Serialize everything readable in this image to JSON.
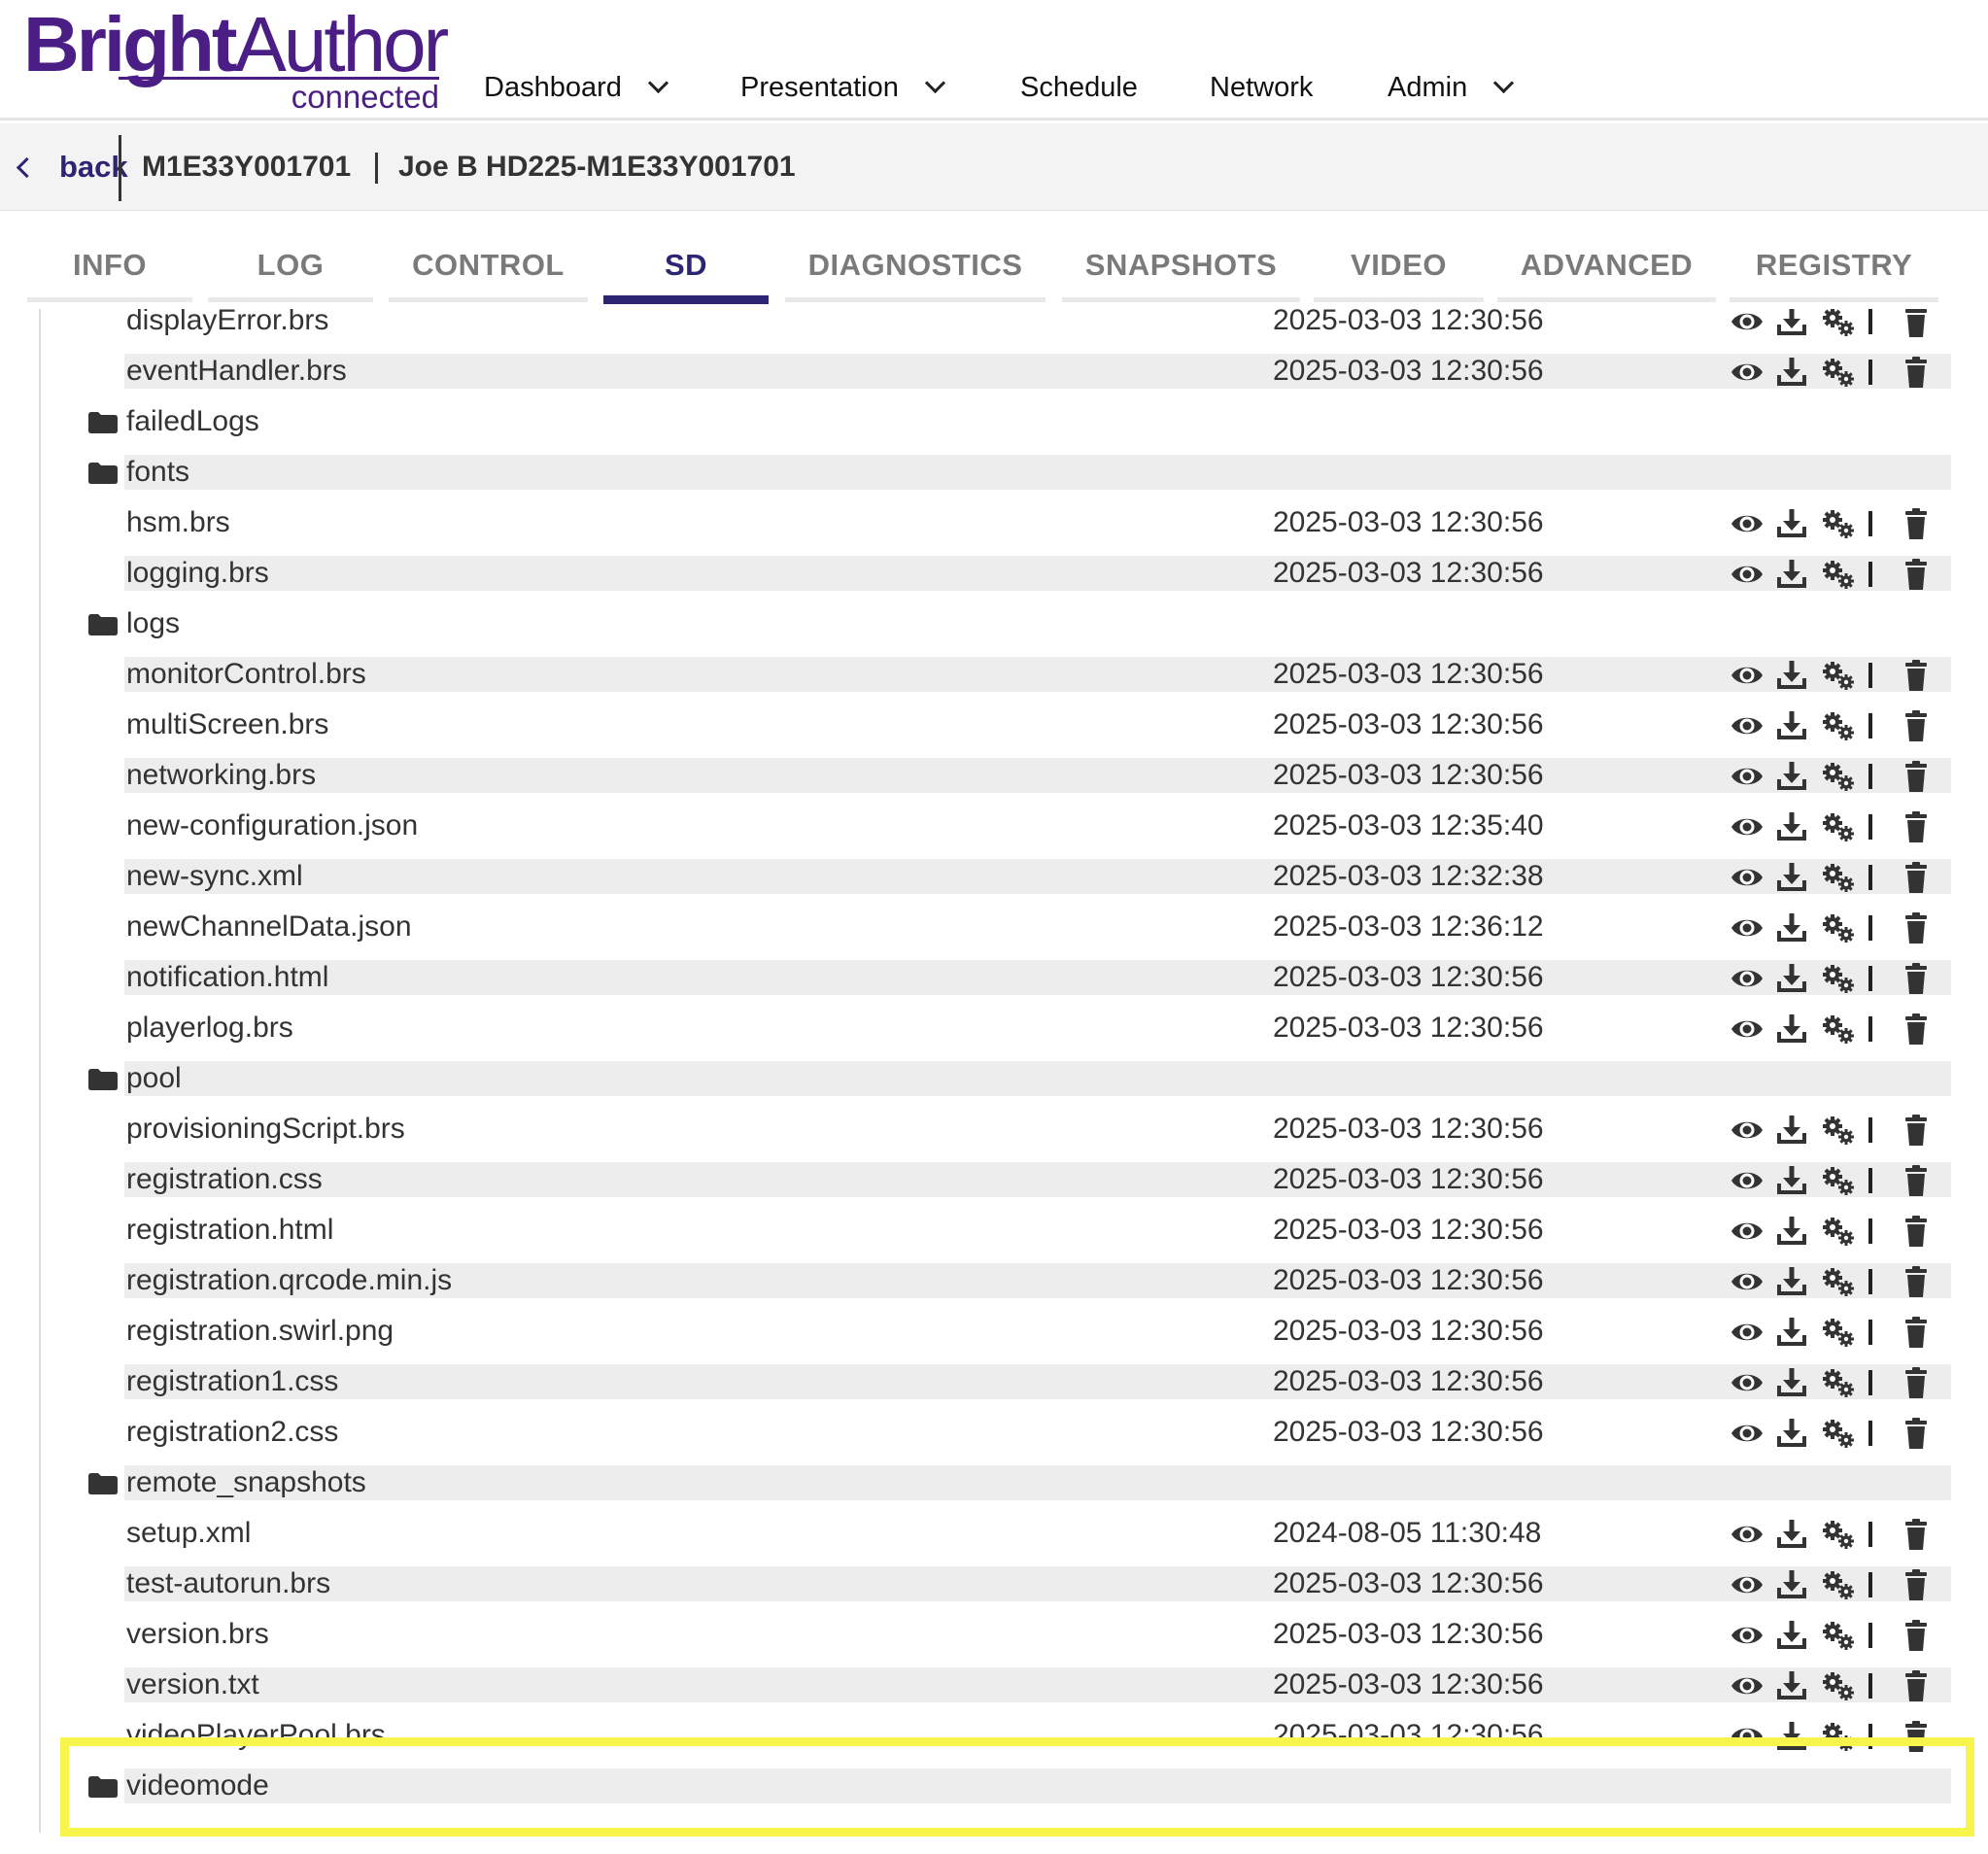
{
  "app": {
    "logo_bold": "Bright",
    "logo_light": "Author",
    "logo_sub": "connected",
    "brand_color": "#4b1e86",
    "accent_color": "#2c2573",
    "highlight_color": "#f7f44c"
  },
  "nav": {
    "items": [
      {
        "label": "Dashboard",
        "has_dropdown": true
      },
      {
        "label": "Presentation",
        "has_dropdown": true
      },
      {
        "label": "Schedule",
        "has_dropdown": false
      },
      {
        "label": "Network",
        "has_dropdown": false
      },
      {
        "label": "Admin",
        "has_dropdown": true
      }
    ]
  },
  "breadcrumb": {
    "back_label": "back",
    "serial": "M1E33Y001701",
    "device_name": "Joe B HD225-M1E33Y001701"
  },
  "tabs": [
    {
      "label": "INFO",
      "active": false
    },
    {
      "label": "LOG",
      "active": false
    },
    {
      "label": "CONTROL",
      "active": false
    },
    {
      "label": "SD",
      "active": true
    },
    {
      "label": "DIAGNOSTICS",
      "active": false
    },
    {
      "label": "SNAPSHOTS",
      "active": false
    },
    {
      "label": "VIDEO",
      "active": false
    },
    {
      "label": "ADVANCED",
      "active": false
    },
    {
      "label": "REGISTRY",
      "active": false
    }
  ],
  "files": [
    {
      "name": "displayError.brs",
      "type": "file",
      "date": "2025-03-03 12:30:56"
    },
    {
      "name": "eventHandler.brs",
      "type": "file",
      "date": "2025-03-03 12:30:56"
    },
    {
      "name": "failedLogs",
      "type": "folder",
      "date": ""
    },
    {
      "name": "fonts",
      "type": "folder",
      "date": ""
    },
    {
      "name": "hsm.brs",
      "type": "file",
      "date": "2025-03-03 12:30:56"
    },
    {
      "name": "logging.brs",
      "type": "file",
      "date": "2025-03-03 12:30:56"
    },
    {
      "name": "logs",
      "type": "folder",
      "date": ""
    },
    {
      "name": "monitorControl.brs",
      "type": "file",
      "date": "2025-03-03 12:30:56"
    },
    {
      "name": "multiScreen.brs",
      "type": "file",
      "date": "2025-03-03 12:30:56"
    },
    {
      "name": "networking.brs",
      "type": "file",
      "date": "2025-03-03 12:30:56"
    },
    {
      "name": "new-configuration.json",
      "type": "file",
      "date": "2025-03-03 12:35:40"
    },
    {
      "name": "new-sync.xml",
      "type": "file",
      "date": "2025-03-03 12:32:38"
    },
    {
      "name": "newChannelData.json",
      "type": "file",
      "date": "2025-03-03 12:36:12"
    },
    {
      "name": "notification.html",
      "type": "file",
      "date": "2025-03-03 12:30:56"
    },
    {
      "name": "playerlog.brs",
      "type": "file",
      "date": "2025-03-03 12:30:56"
    },
    {
      "name": "pool",
      "type": "folder",
      "date": ""
    },
    {
      "name": "provisioningScript.brs",
      "type": "file",
      "date": "2025-03-03 12:30:56"
    },
    {
      "name": "registration.css",
      "type": "file",
      "date": "2025-03-03 12:30:56"
    },
    {
      "name": "registration.html",
      "type": "file",
      "date": "2025-03-03 12:30:56"
    },
    {
      "name": "registration.qrcode.min.js",
      "type": "file",
      "date": "2025-03-03 12:30:56"
    },
    {
      "name": "registration.swirl.png",
      "type": "file",
      "date": "2025-03-03 12:30:56"
    },
    {
      "name": "registration1.css",
      "type": "file",
      "date": "2025-03-03 12:30:56"
    },
    {
      "name": "registration2.css",
      "type": "file",
      "date": "2025-03-03 12:30:56"
    },
    {
      "name": "remote_snapshots",
      "type": "folder",
      "date": ""
    },
    {
      "name": "setup.xml",
      "type": "file",
      "date": "2024-08-05 11:30:48"
    },
    {
      "name": "test-autorun.brs",
      "type": "file",
      "date": "2025-03-03 12:30:56"
    },
    {
      "name": "version.brs",
      "type": "file",
      "date": "2025-03-03 12:30:56"
    },
    {
      "name": "version.txt",
      "type": "file",
      "date": "2025-03-03 12:30:56"
    },
    {
      "name": "videoPlayerPool.brs",
      "type": "file",
      "date": "2025-03-03 12:30:56"
    },
    {
      "name": "videomode",
      "type": "folder",
      "date": ""
    }
  ],
  "row_actions": [
    "eye-icon",
    "download-icon",
    "gears-icon",
    "trash-icon"
  ]
}
